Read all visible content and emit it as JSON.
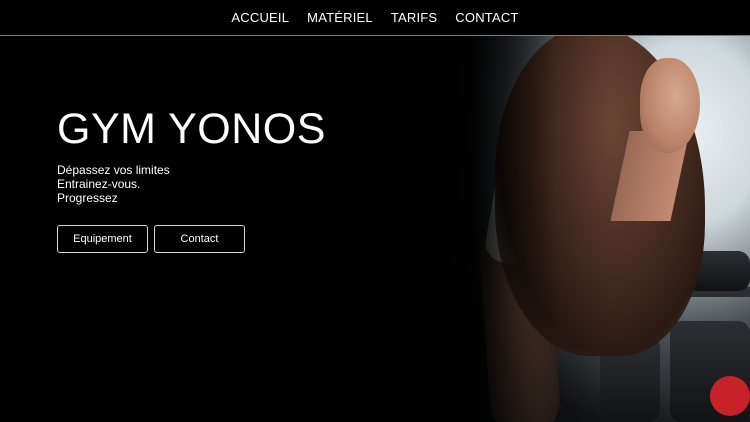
{
  "nav": {
    "items": [
      {
        "label": "ACCUEIL"
      },
      {
        "label": "MATÉRIEL"
      },
      {
        "label": "TARIFS"
      },
      {
        "label": "CONTACT"
      }
    ]
  },
  "hero": {
    "title": "GYM YONOS",
    "lines": [
      "Dépassez vos limites",
      "Entrainez-vous.",
      "Progressez"
    ],
    "buttons": [
      {
        "label": "Equipement"
      },
      {
        "label": "Contact"
      }
    ]
  }
}
